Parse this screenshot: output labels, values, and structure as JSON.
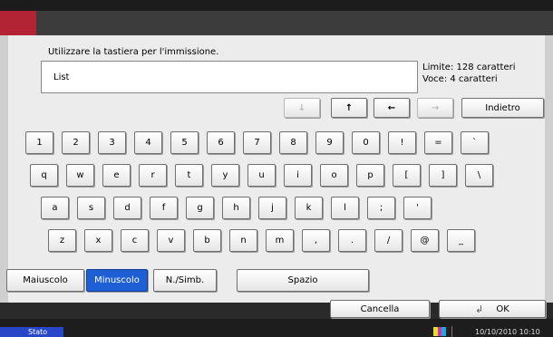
{
  "prompt": "Utilizzare la tastiera per l'immissione.",
  "input": {
    "value": "List"
  },
  "info": {
    "limit": "Limite: 128 caratteri",
    "count": "Voce: 4 caratteri"
  },
  "nav": {
    "down": "↓",
    "up": "↑",
    "left": "←",
    "right": "→",
    "back": "Indietro"
  },
  "rows": [
    [
      "1",
      "2",
      "3",
      "4",
      "5",
      "6",
      "7",
      "8",
      "9",
      "0",
      "!",
      "=",
      "`"
    ],
    [
      "q",
      "w",
      "e",
      "r",
      "t",
      "y",
      "u",
      "i",
      "o",
      "p",
      "[",
      "]",
      "\\"
    ],
    [
      "a",
      "s",
      "d",
      "f",
      "g",
      "h",
      "j",
      "k",
      "l",
      ";",
      "'"
    ],
    [
      "z",
      "x",
      "c",
      "v",
      "b",
      "n",
      "m",
      ",",
      ".",
      "/",
      "@",
      "_"
    ]
  ],
  "modes": {
    "upper": "Maiuscolo",
    "lower": "Minuscolo",
    "symbols": "N./Simb.",
    "space": "Spazio"
  },
  "actions": {
    "cancel": "Cancella",
    "ok": "OK"
  },
  "status": {
    "tab": "Stato",
    "datetime": "10/10/2010  10:10"
  },
  "colors": {
    "accent": "#b22434",
    "active": "#1e5fd6"
  }
}
